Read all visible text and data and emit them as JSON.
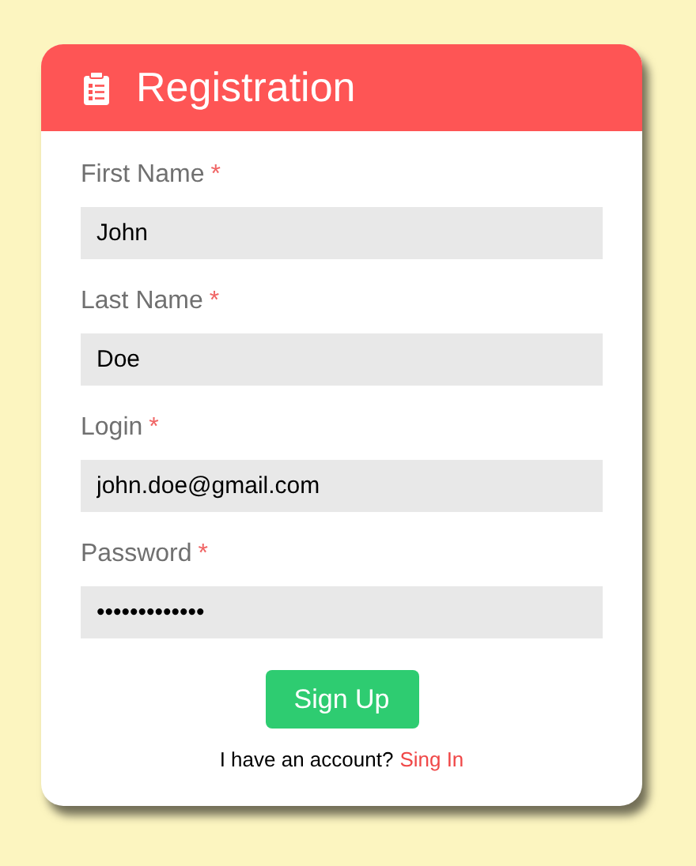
{
  "header": {
    "title": "Registration"
  },
  "fields": [
    {
      "label": "First Name",
      "required_mark": "*",
      "value": "John"
    },
    {
      "label": "Last Name",
      "required_mark": "*",
      "value": "Doe"
    },
    {
      "label": "Login",
      "required_mark": "*",
      "value": "john.doe@gmail.com"
    },
    {
      "label": "Password",
      "required_mark": "*",
      "value": "•••••••••••••"
    }
  ],
  "submit": "Sign Up",
  "footer": {
    "text": "I have an account?",
    "link": "Sing In"
  }
}
